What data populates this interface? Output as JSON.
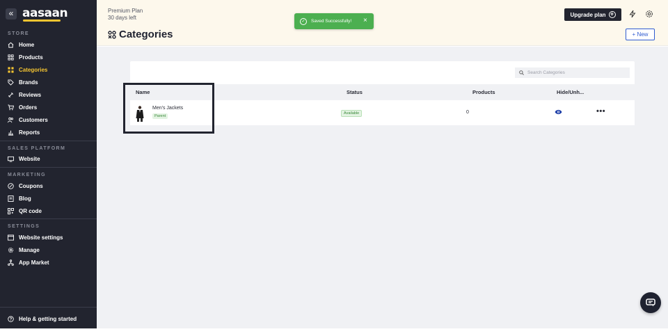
{
  "sidebar": {
    "logo": "aasaan",
    "collapse_icon": "«",
    "sections": {
      "store": "STORE",
      "sales_platform": "SALES PLATFORM",
      "marketing": "MARKETING",
      "settings": "SETTINGS"
    },
    "items": {
      "home": "Home",
      "products": "Products",
      "categories": "Categories",
      "brands": "Brands",
      "reviews": "Reviews",
      "orders": "Orders",
      "customers": "Customers",
      "reports": "Reports",
      "website": "Website",
      "coupons": "Coupons",
      "blog": "Blog",
      "qr_code": "QR code",
      "website_settings": "Website settings",
      "manage": "Manage",
      "app_market": "App Market"
    },
    "help": "Help & getting started",
    "active_color": "#f5c531"
  },
  "topbar": {
    "plan_name": "Premium Plan",
    "plan_days": "30 days left",
    "page_title": "Categories",
    "upgrade_label": "Upgrade plan",
    "new_label": "+ New"
  },
  "toast": {
    "message": "Saved Successfully!",
    "close": "×",
    "color": "#4caf50"
  },
  "table": {
    "search_placeholder": "Search Categories",
    "headers": {
      "name": "Name",
      "status": "Status",
      "products": "Products",
      "visibility": "Hide/Unh..."
    },
    "rows": [
      {
        "name": "Men's Jackets",
        "badge": "Parent",
        "status": "Available",
        "products": "0",
        "more": "•••"
      }
    ]
  }
}
